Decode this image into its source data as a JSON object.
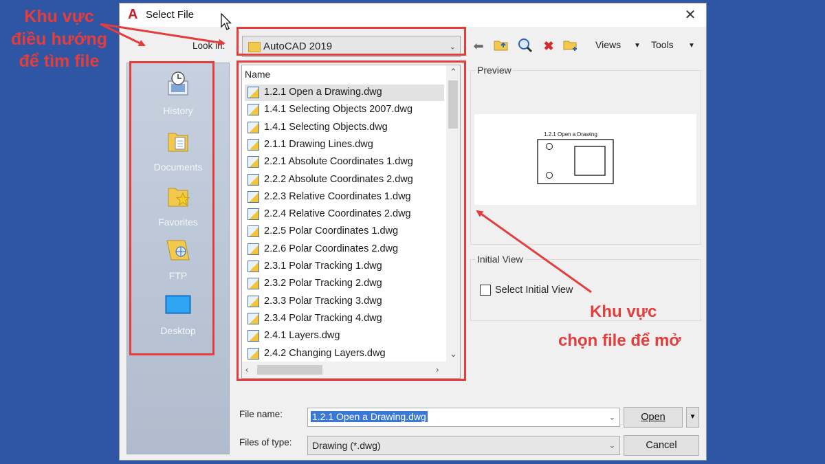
{
  "dialog": {
    "title": "Select File",
    "app_logo": "A",
    "close_glyph": "✕"
  },
  "toolbar": {
    "look_in_label": "Look in:",
    "look_in_value": "AutoCAD 2019",
    "views_label": "Views",
    "tools_label": "Tools",
    "icons": [
      "back-icon",
      "up-folder-icon",
      "search-web-icon",
      "delete-icon",
      "new-folder-icon"
    ]
  },
  "places": [
    {
      "label": "History",
      "icon": "history-icon"
    },
    {
      "label": "Documents",
      "icon": "documents-icon"
    },
    {
      "label": "Favorites",
      "icon": "favorites-icon"
    },
    {
      "label": "FTP",
      "icon": "ftp-icon"
    },
    {
      "label": "Desktop",
      "icon": "desktop-icon"
    }
  ],
  "file_list": {
    "column_header": "Name",
    "selected_index": 0,
    "files": [
      "1.2.1 Open a Drawing.dwg",
      "1.4.1 Selecting Objects 2007.dwg",
      "1.4.1 Selecting Objects.dwg",
      "2.1.1 Drawing Lines.dwg",
      "2.2.1 Absolute Coordinates 1.dwg",
      "2.2.2 Absolute Coordinates 2.dwg",
      "2.2.3 Relative Coordinates 1.dwg",
      "2.2.4 Relative Coordinates 2.dwg",
      "2.2.5 Polar Coordinates 1.dwg",
      "2.2.6 Polar Coordinates 2.dwg",
      "2.3.1 Polar Tracking 1.dwg",
      "2.3.2 Polar Tracking 2.dwg",
      "2.3.3 Polar Tracking 3.dwg",
      "2.3.4 Polar Tracking 4.dwg",
      "2.4.1 Layers.dwg",
      "2.4.2 Changing Layers.dwg"
    ]
  },
  "preview": {
    "label": "Preview",
    "thumbnail_title": "1.2.1 Open a Drawing"
  },
  "initial_view": {
    "label": "Initial View",
    "checkbox_label": "Select Initial View",
    "checked": false
  },
  "bottom": {
    "file_name_label": "File name:",
    "file_name_value": "1.2.1 Open a Drawing.dwg",
    "files_of_type_label": "Files of type:",
    "files_of_type_value": "Drawing (*.dwg)",
    "open_label": "Open",
    "cancel_label": "Cancel"
  },
  "annotations": {
    "nav_area_lines": [
      "Khu vực",
      "điều hướng",
      "để tìm file"
    ],
    "file_area_lines": [
      "Khu vực",
      "chọn file để mở"
    ],
    "color": "#e53c3c"
  }
}
